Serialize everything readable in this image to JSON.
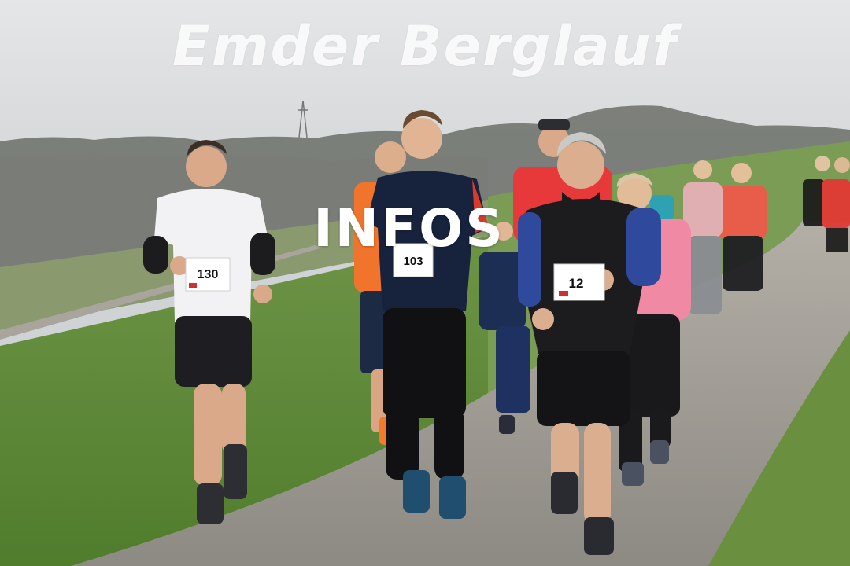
{
  "overlay": {
    "title": "Emder Berglauf",
    "link_label": "INFOS"
  },
  "bibs": {
    "runner_a": "130",
    "runner_b": "103",
    "runner_c": "12"
  },
  "colors": {
    "sky": "#d7dadc",
    "grass": "#5f8a36",
    "path": "#9c9891",
    "treeline": "#5f625c"
  }
}
